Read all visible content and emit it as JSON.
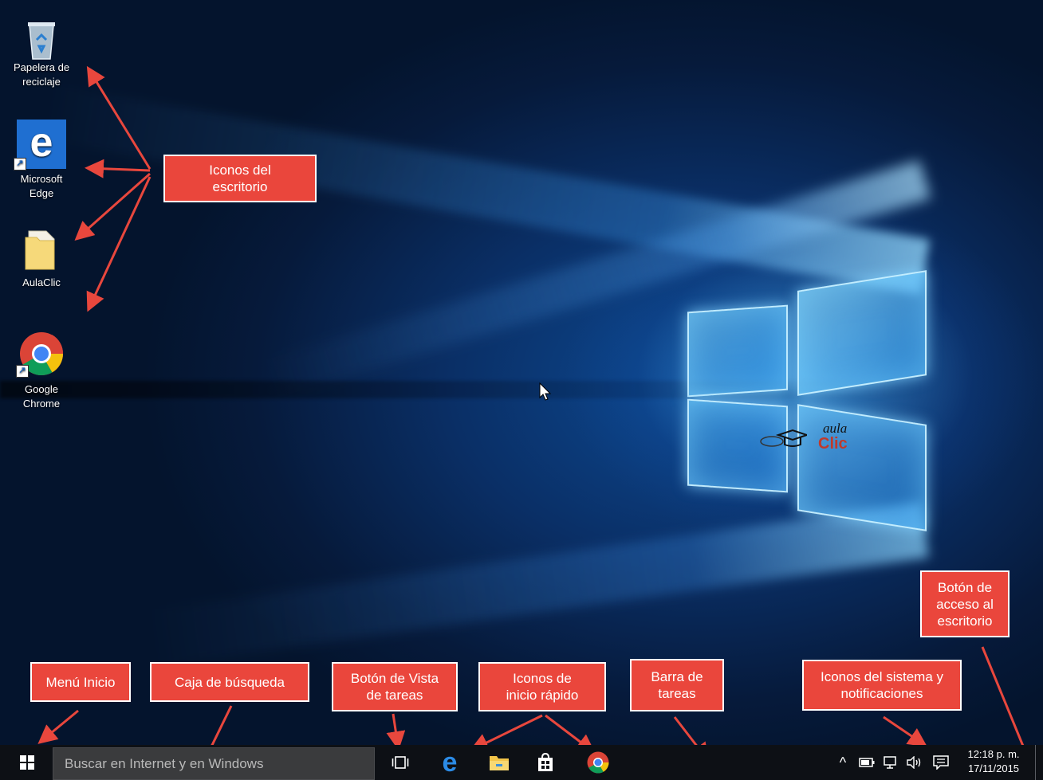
{
  "desktop": {
    "icons": [
      {
        "label_line1": "Papelera de",
        "label_line2": "reciclaje",
        "icon": "recycle-bin-icon"
      },
      {
        "label_line1": "Microsoft",
        "label_line2": "Edge",
        "icon": "edge-icon"
      },
      {
        "label_line1": "AulaClic",
        "label_line2": "",
        "icon": "folder-icon"
      },
      {
        "label_line1": "Google",
        "label_line2": "Chrome",
        "icon": "chrome-icon"
      }
    ],
    "watermark": {
      "line1": "aula",
      "line2": "Clic"
    }
  },
  "callouts": {
    "desktop_icons": {
      "line1": "Iconos del",
      "line2": "escritorio"
    },
    "start_menu": {
      "line1": "Menú Inicio"
    },
    "search_box": {
      "line1": "Caja de búsqueda"
    },
    "task_view": {
      "line1": "Botón de Vista",
      "line2": "de tareas"
    },
    "quick_launch": {
      "line1": "Iconos de",
      "line2": "inicio rápido"
    },
    "taskbar": {
      "line1": "Barra de",
      "line2": "tareas"
    },
    "system_icons": {
      "line1": "Iconos del sistema y",
      "line2": "notificaciones"
    },
    "show_desktop": {
      "line1": "Botón de",
      "line2": "acceso al",
      "line3": "escritorio"
    }
  },
  "taskbar": {
    "search_placeholder": "Buscar en Internet y en Windows",
    "pinned": [
      "task-view-icon",
      "edge-icon",
      "file-explorer-icon",
      "store-icon",
      "chrome-icon"
    ],
    "tray_icons": [
      "chevron-up-icon",
      "battery-icon",
      "network-icon",
      "volume-icon",
      "notifications-icon"
    ],
    "clock": {
      "time": "12:18 p. m.",
      "date": "17/11/2015"
    }
  },
  "colors": {
    "callout": "#ea463c",
    "taskbar": "#0d1015",
    "wallpaper_glow": "#5abeff"
  }
}
